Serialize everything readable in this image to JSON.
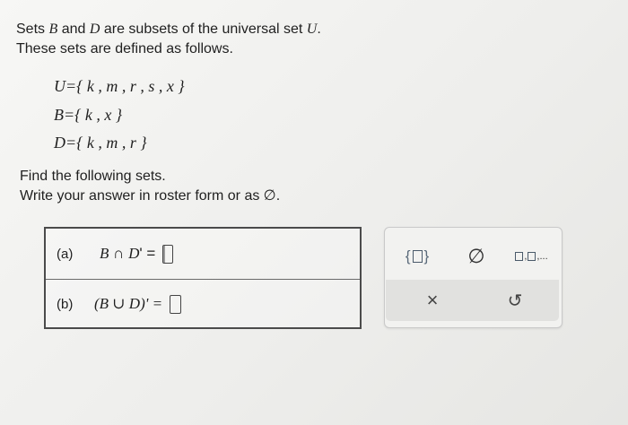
{
  "problem": {
    "line1_prefix": "Sets ",
    "set_b": "B",
    "line1_and": " and ",
    "set_d": "D",
    "line1_mid": " are subsets of the universal set ",
    "set_u": "U",
    "line1_end": ".",
    "line2": "These sets are defined as follows."
  },
  "sets": {
    "u": "U={ k , m , r , s , x }",
    "b": "B={ k , x }",
    "d": "D={ k , m , r }"
  },
  "instructions": {
    "line1": "Find the following sets.",
    "line2": "Write your answer in roster form or as ∅."
  },
  "answers": {
    "a": {
      "label": "(a)",
      "left": "B",
      "op": " ∩ ",
      "right": "D",
      "suffix": "' =",
      "value": ""
    },
    "b": {
      "label": "(b)",
      "expr": "(B ∪ D)' =",
      "value": ""
    }
  },
  "palette": {
    "braces_left": "{",
    "braces_right": "}",
    "empty_set": "∅",
    "list_dots": ",...",
    "list_sep": ",",
    "clear": "×",
    "reset": "↺"
  }
}
